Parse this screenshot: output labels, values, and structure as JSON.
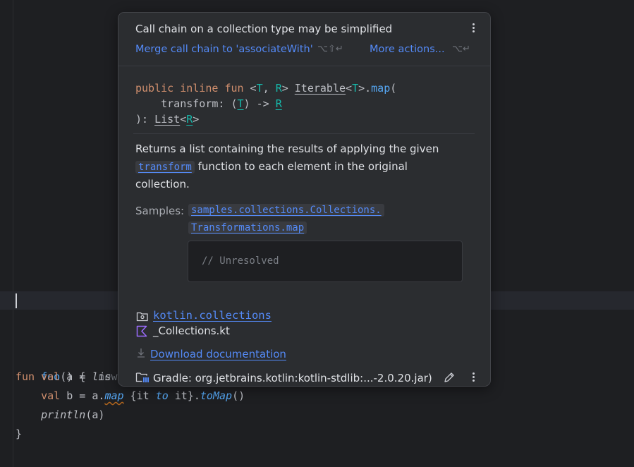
{
  "editor": {
    "line1": {
      "kw": "fun",
      "fn": "foo",
      "rest": "() {",
      "hint": "new"
    },
    "line2": {
      "kw": "val",
      "var": " a = ",
      "call": "lis"
    },
    "line3": {
      "kw": "val",
      "var": " b = a.",
      "call": "map",
      "lambda_open": " {it ",
      "infix": "to",
      "lambda_close": " it}.",
      "ext": "toMap",
      "tail": "()"
    },
    "line4": {
      "call": "println",
      "args": "(a)"
    },
    "line5": {
      "brace": "}"
    }
  },
  "popup": {
    "title": "Call chain on a collection type may be simplified",
    "primary_action": "Merge call chain to 'associateWith'",
    "primary_shortcut": "⌥⇧↵",
    "more_actions": "More actions...",
    "more_shortcut": "⌥↵",
    "signature": {
      "p1": "public",
      "p2": "inline",
      "p3": "fun",
      "lt": " <",
      "T": "T",
      "comma": ", ",
      "R": "R",
      "gt": "> ",
      "iterable": "Iterable",
      "lt2": "<",
      "T2": "T",
      "gt2": ">.",
      "map": "map",
      "paren": "(",
      "indent": "    transform: (",
      "T3": "T",
      "arrow": ") -> ",
      "R2": "R",
      "close": "): ",
      "list": "List",
      "lt3": "<",
      "R3": "R",
      "gt3": ">"
    },
    "description": {
      "before": "Returns a list containing the results of applying the given ",
      "param": "transform",
      "after": " function to each element in the original collection."
    },
    "samples_label": "Samples:",
    "samples_link_1": "samples.collections.Collections.",
    "samples_link_2": "Transformations.map",
    "unresolved": "// Unresolved",
    "package": "kotlin.collections",
    "file": "_Collections.kt",
    "download": "Download documentation",
    "library": "Gradle: org.jetbrains.kotlin:kotlin-stdlib:...-2.0.20.jar)"
  },
  "colors": {
    "accent": "#548af7",
    "keyword": "#cf8e6d",
    "function": "#56a8f5",
    "type_param": "#16baac",
    "kotlin_icon": "#9b6dff"
  }
}
